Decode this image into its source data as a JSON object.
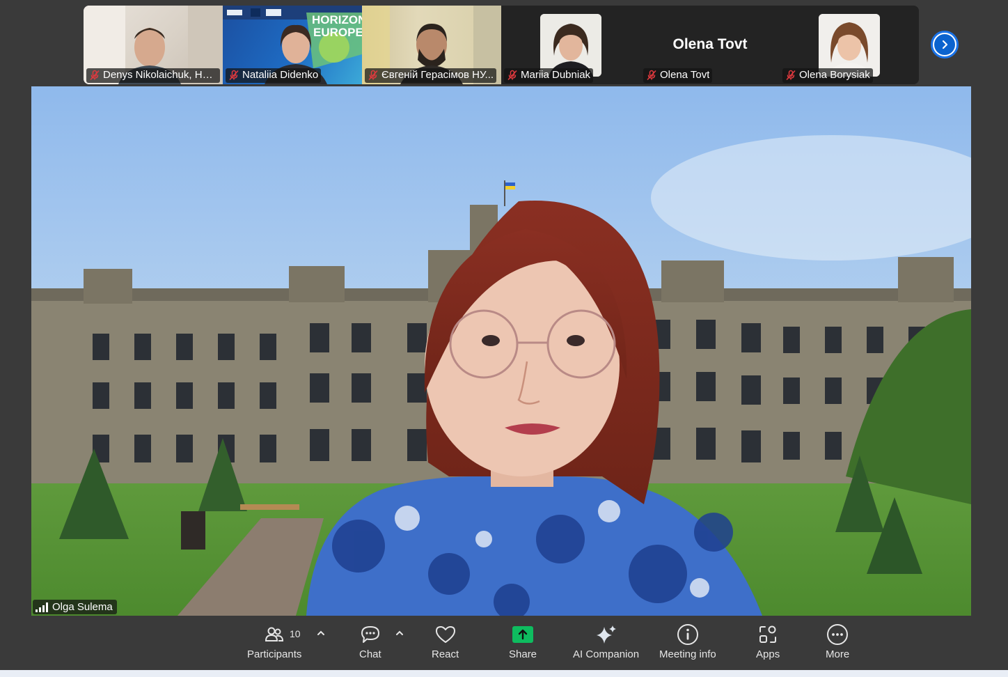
{
  "filmstrip": {
    "participants": [
      {
        "name": "Denys Nikolaichuk, HE...",
        "mic": "muted",
        "view": "camera"
      },
      {
        "name": "Nataliia Didenko",
        "mic": "muted",
        "view": "camera",
        "background_text": "HORIZON EUROPE"
      },
      {
        "name": "Євгеній Герасімов НУ...",
        "mic": "muted",
        "view": "camera"
      },
      {
        "name": "Mariia Dubniak",
        "mic": "muted",
        "view": "profile-photo"
      },
      {
        "name": "Olena Tovt",
        "mic": "muted",
        "view": "name-only",
        "display_title": "Olena Tovt"
      },
      {
        "name": "Olena Borysiak",
        "mic": "muted",
        "view": "profile-photo"
      }
    ],
    "next_icon": "chevron-right-icon"
  },
  "main": {
    "speaker_name": "Olga Sulema",
    "signal_icon": "signal-bars-icon"
  },
  "toolbar": {
    "participants_label": "Participants",
    "participants_count": "10",
    "chat_label": "Chat",
    "react_label": "React",
    "share_label": "Share",
    "ai_label": "AI Companion",
    "info_label": "Meeting info",
    "apps_label": "Apps",
    "more_label": "More"
  },
  "colors": {
    "background": "#3a3a3a",
    "share_green": "#0ebc5f",
    "accent_blue": "#0b63ce",
    "muted_red": "#e0393e"
  }
}
